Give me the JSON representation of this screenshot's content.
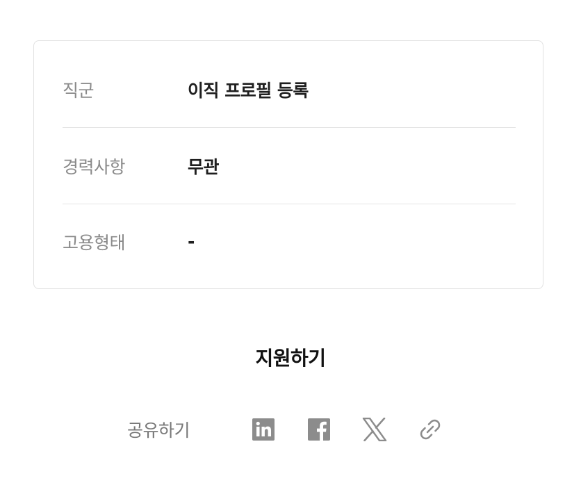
{
  "job_info": {
    "rows": [
      {
        "label": "직군",
        "value": "이직 프로필 등록"
      },
      {
        "label": "경력사항",
        "value": "무관"
      },
      {
        "label": "고용형태",
        "value": "-"
      }
    ]
  },
  "apply": {
    "label": "지원하기"
  },
  "share": {
    "label": "공유하기",
    "icons": [
      "linkedin-icon",
      "facebook-icon",
      "x-icon",
      "link-icon"
    ]
  },
  "colors": {
    "label_text": "#8a8a8a",
    "value_text": "#1f1f1f",
    "icon": "#8c8c8c",
    "border": "#e1e1e1"
  }
}
